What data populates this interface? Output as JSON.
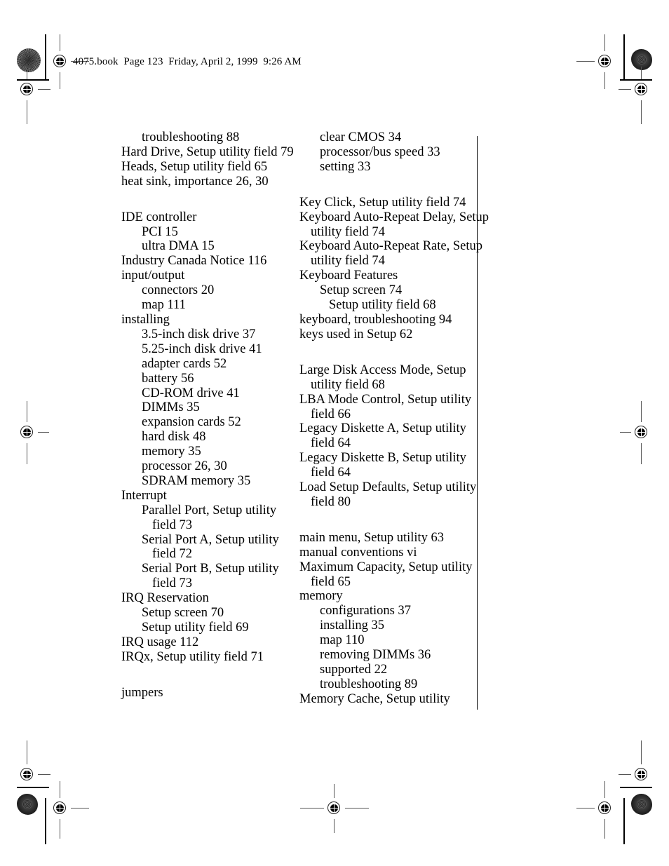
{
  "page": {
    "header_line": "4075.book  Page 123  Friday, April 2, 1999  9:26 AM",
    "page_number": "123",
    "document_name": "4075.book",
    "date": "Friday, April 2, 1999",
    "time": "9:26 AM",
    "background_color": "#ffffff",
    "text_color": "#000000"
  },
  "index": {
    "left_column": [
      {
        "text": "troubleshooting 88",
        "level": "lvl1"
      },
      {
        "text": "Hard Drive, Setup utility field 79",
        "level": "lvl0"
      },
      {
        "text": "Heads, Setup utility field 65",
        "level": "lvl0"
      },
      {
        "text": "heat sink, importance 26, 30",
        "level": "lvl0"
      },
      {
        "text": "",
        "level": "gap"
      },
      {
        "text": "IDE controller",
        "level": "lvl0"
      },
      {
        "text": "PCI 15",
        "level": "lvl1"
      },
      {
        "text": "ultra DMA 15",
        "level": "lvl1"
      },
      {
        "text": "Industry Canada Notice 116",
        "level": "lvl0"
      },
      {
        "text": "input/output",
        "level": "lvl0"
      },
      {
        "text": "connectors 20",
        "level": "lvl1"
      },
      {
        "text": "map 111",
        "level": "lvl1"
      },
      {
        "text": "installing",
        "level": "lvl0"
      },
      {
        "text": "3.5-inch disk drive 37",
        "level": "lvl1"
      },
      {
        "text": "5.25-inch disk drive 41",
        "level": "lvl1"
      },
      {
        "text": "adapter cards 52",
        "level": "lvl1"
      },
      {
        "text": "battery 56",
        "level": "lvl1"
      },
      {
        "text": "CD-ROM drive 41",
        "level": "lvl1"
      },
      {
        "text": "DIMMs 35",
        "level": "lvl1"
      },
      {
        "text": "expansion cards 52",
        "level": "lvl1"
      },
      {
        "text": "hard disk 48",
        "level": "lvl1"
      },
      {
        "text": "memory 35",
        "level": "lvl1"
      },
      {
        "text": "processor 26, 30",
        "level": "lvl1"
      },
      {
        "text": "SDRAM memory 35",
        "level": "lvl1"
      },
      {
        "text": "Interrupt",
        "level": "lvl0"
      },
      {
        "text": "Parallel Port, Setup utility",
        "level": "lvl1"
      },
      {
        "text": "field 73",
        "level": "cont2"
      },
      {
        "text": "Serial Port A, Setup utility",
        "level": "lvl1"
      },
      {
        "text": "field 72",
        "level": "cont2"
      },
      {
        "text": "Serial Port B, Setup utility",
        "level": "lvl1"
      },
      {
        "text": "field 73",
        "level": "cont2"
      },
      {
        "text": "IRQ Reservation",
        "level": "lvl0"
      },
      {
        "text": "Setup screen 70",
        "level": "lvl1"
      },
      {
        "text": "Setup utility field 69",
        "level": "lvl1"
      },
      {
        "text": "IRQ usage 112",
        "level": "lvl0"
      },
      {
        "text": "IRQx, Setup utility field 71",
        "level": "lvl0"
      },
      {
        "text": "",
        "level": "gap"
      },
      {
        "text": "jumpers",
        "level": "lvl0"
      }
    ],
    "right_column": [
      {
        "text": "clear CMOS 34",
        "level": "lvl1"
      },
      {
        "text": "processor/bus speed 33",
        "level": "lvl1"
      },
      {
        "text": "setting 33",
        "level": "lvl1"
      },
      {
        "text": "",
        "level": "gap"
      },
      {
        "text": "Key Click, Setup utility field 74",
        "level": "lvl0"
      },
      {
        "text": "Keyboard Auto-Repeat Delay, Setup",
        "level": "lvl0"
      },
      {
        "text": "utility field 74",
        "level": "cont1"
      },
      {
        "text": "Keyboard Auto-Repeat Rate, Setup",
        "level": "lvl0"
      },
      {
        "text": "utility field 74",
        "level": "cont1"
      },
      {
        "text": "Keyboard Features",
        "level": "lvl0"
      },
      {
        "text": "Setup screen 74",
        "level": "lvl1"
      },
      {
        "text": "Setup utility field 68",
        "level": "lvl2"
      },
      {
        "text": "keyboard, troubleshooting 94",
        "level": "lvl0"
      },
      {
        "text": "keys used in Setup 62",
        "level": "lvl0"
      },
      {
        "text": "",
        "level": "gap"
      },
      {
        "text": "Large Disk Access Mode, Setup",
        "level": "lvl0"
      },
      {
        "text": "utility field 68",
        "level": "cont1"
      },
      {
        "text": "LBA Mode Control, Setup utility",
        "level": "lvl0"
      },
      {
        "text": "field 66",
        "level": "cont1"
      },
      {
        "text": "Legacy Diskette A, Setup utility",
        "level": "lvl0"
      },
      {
        "text": "field 64",
        "level": "cont1"
      },
      {
        "text": "Legacy Diskette B, Setup utility",
        "level": "lvl0"
      },
      {
        "text": "field 64",
        "level": "cont1"
      },
      {
        "text": "Load Setup Defaults, Setup utility",
        "level": "lvl0"
      },
      {
        "text": "field 80",
        "level": "cont1"
      },
      {
        "text": "",
        "level": "gap"
      },
      {
        "text": "main menu, Setup utility 63",
        "level": "lvl0"
      },
      {
        "text": "manual conventions vi",
        "level": "lvl0"
      },
      {
        "text": "Maximum Capacity, Setup utility",
        "level": "lvl0"
      },
      {
        "text": "field 65",
        "level": "cont1"
      },
      {
        "text": "memory",
        "level": "lvl0"
      },
      {
        "text": "configurations 37",
        "level": "lvl1"
      },
      {
        "text": "installing 35",
        "level": "lvl1"
      },
      {
        "text": "map 110",
        "level": "lvl1"
      },
      {
        "text": "removing DIMMs 36",
        "level": "lvl1"
      },
      {
        "text": "supported 22",
        "level": "lvl1"
      },
      {
        "text": "troubleshooting 89",
        "level": "lvl1"
      },
      {
        "text": "Memory Cache, Setup utility",
        "level": "lvl0"
      }
    ]
  },
  "printer_marks": {
    "registration_target_label": "registration-target",
    "halftone_label": "halftone-screen-patch",
    "density_patch_label": "solid-density-patch",
    "crop_mark_label": "crop-mark",
    "column_rule_label": "column-boundary-rule"
  }
}
